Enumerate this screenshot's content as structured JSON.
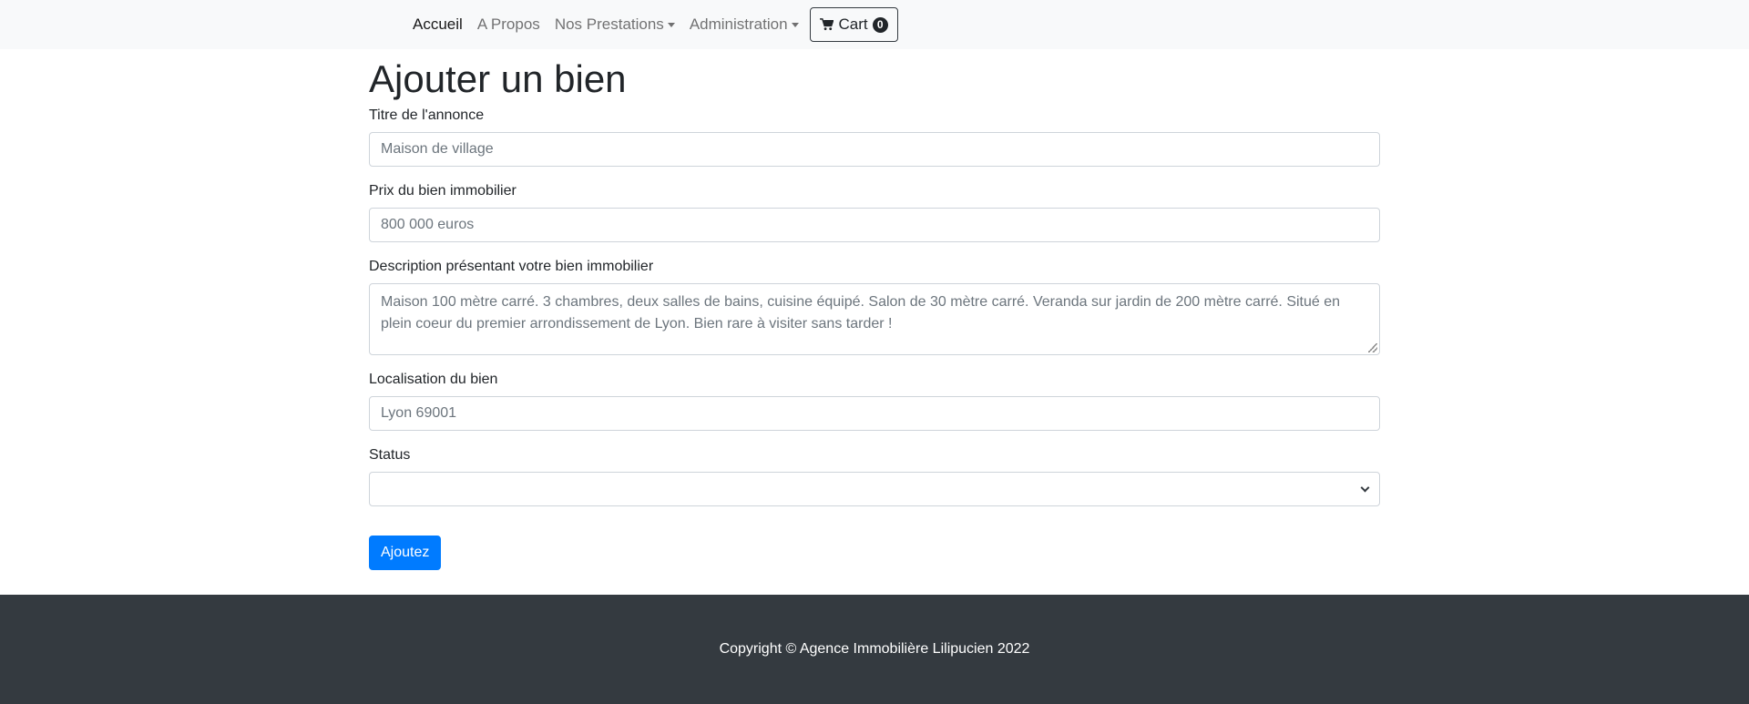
{
  "nav": {
    "home": "Accueil",
    "about": "A Propos",
    "services": "Nos Prestations",
    "admin": "Administration",
    "cart_label": "Cart",
    "cart_count": "0"
  },
  "page": {
    "title": "Ajouter un bien"
  },
  "form": {
    "title": {
      "label": "Titre de l'annonce",
      "placeholder": "Maison de village"
    },
    "price": {
      "label": "Prix du bien immobilier",
      "placeholder": "800 000 euros"
    },
    "description": {
      "label": "Description présentant votre bien immobilier",
      "placeholder": "Maison 100 mètre carré. 3 chambres, deux salles de bains, cuisine équipé. Salon de 30 mètre carré. Veranda sur jardin de 200 mètre carré. Situé en plein coeur du premier arrondissement de Lyon. Bien rare à visiter sans tarder !"
    },
    "location": {
      "label": "Localisation du bien",
      "placeholder": "Lyon 69001"
    },
    "status": {
      "label": "Status",
      "value": ""
    },
    "submit": "Ajoutez"
  },
  "footer": {
    "copyright": "Copyright © Agence Immobilière Lilipucien 2022"
  },
  "colors": {
    "primary": "#007bff",
    "footer_bg": "#343a40",
    "navbar_bg": "#f8f9fa"
  }
}
